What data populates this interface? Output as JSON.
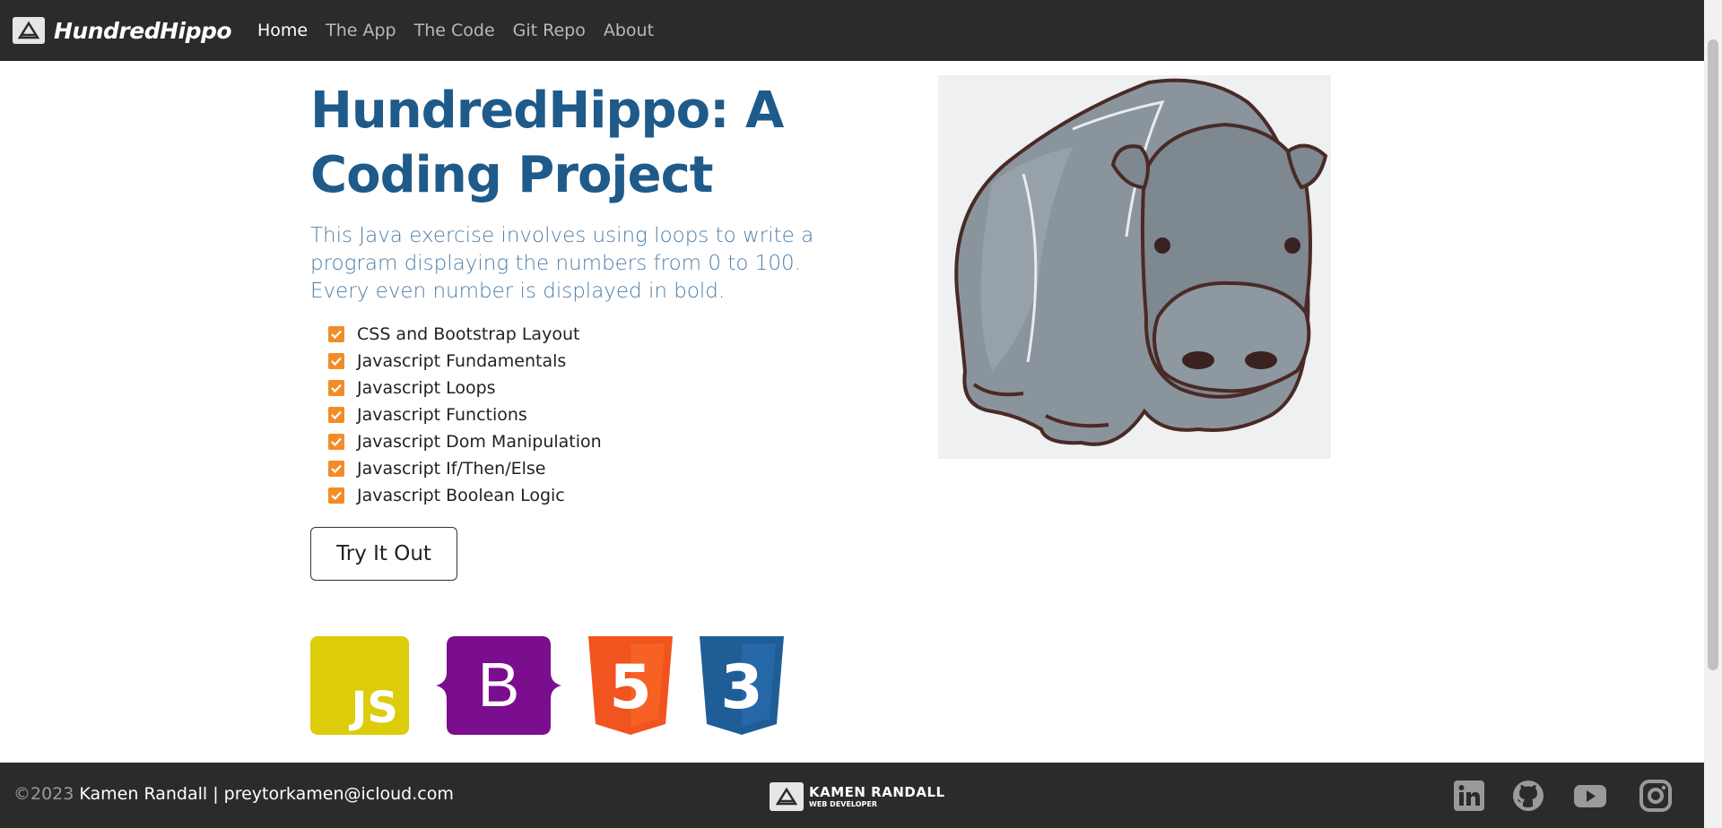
{
  "navbar": {
    "brand_name": "HundredHippo",
    "items": [
      {
        "label": "Home",
        "active": true
      },
      {
        "label": "The App",
        "active": false
      },
      {
        "label": "The Code",
        "active": false
      },
      {
        "label": "Git Repo",
        "active": false
      },
      {
        "label": "About",
        "active": false
      }
    ]
  },
  "hero": {
    "title_line1": "HundredHippo: A",
    "title_line2": "Coding Project",
    "lead": "This Java exercise involves using loops to write a program displaying the numbers from 0 to 100. Every even number is displayed in bold.",
    "features": [
      "CSS and Bootstrap Layout",
      "Javascript Fundamentals",
      "Javascript Loops",
      "Javascript Functions",
      "Javascript Dom Manipulation",
      "Javascript If/Then/Else",
      "Javascript Boolean Logic"
    ],
    "cta_label": "Try It Out"
  },
  "tech_icons": {
    "js_text": "JS",
    "bootstrap_text": "B",
    "html_text": "5",
    "css_text": "3",
    "names": [
      "javascript-logo-icon",
      "bootstrap-logo-icon",
      "html5-logo-icon",
      "css3-logo-icon"
    ]
  },
  "footer": {
    "copyright_symbol_year": "©2023",
    "author_contact": " Kamen Randall | preytorkamen@icloud.com",
    "logo_name": "KAMEN RANDALL",
    "logo_subtitle": "WEB DEVELOPER",
    "social": [
      "linkedin-icon",
      "github-icon",
      "youtube-icon",
      "instagram-icon"
    ]
  },
  "colors": {
    "navbar_bg": "#2b2b2b",
    "title": "#1e5a8a",
    "lead": "#4f7ea8",
    "check": "#f28c28",
    "js": "#dccc0a",
    "bootstrap": "#7b0e8e",
    "html5": "#f1541f",
    "css3": "#1f5d97"
  }
}
